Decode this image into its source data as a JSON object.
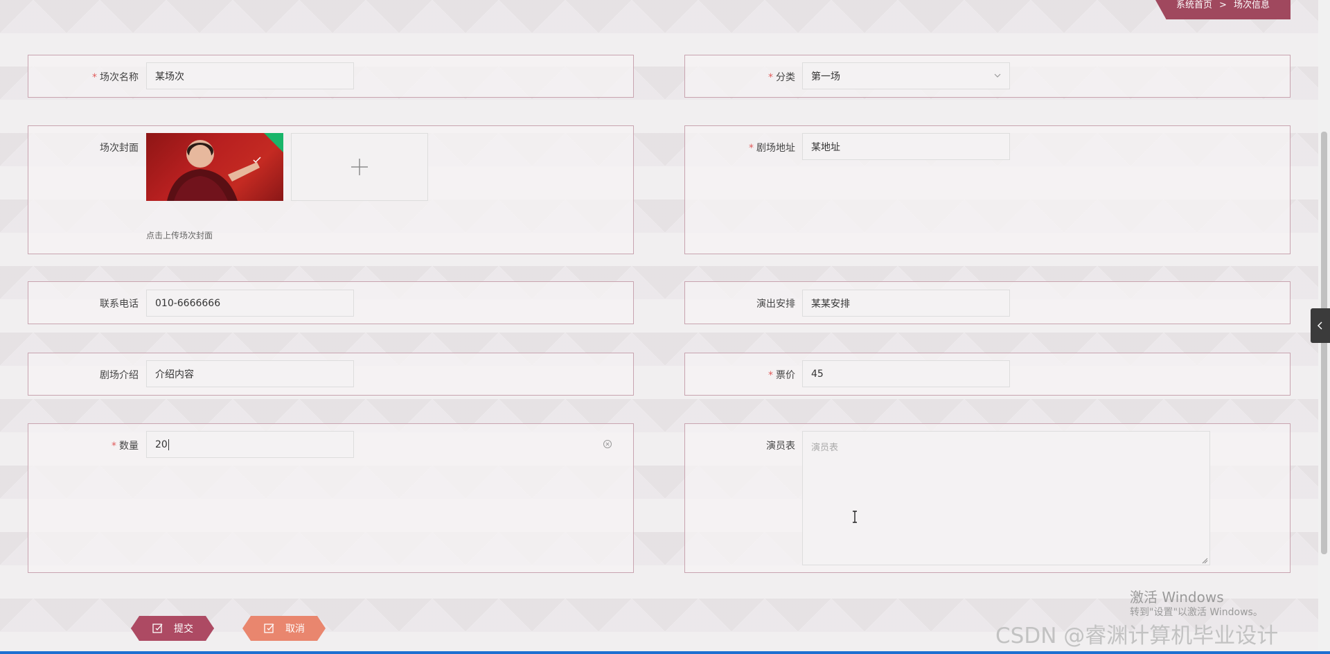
{
  "breadcrumb": {
    "home": "系统首页",
    "separator": ">",
    "current": "场次信息"
  },
  "form": {
    "name": {
      "label": "场次名称",
      "required": true,
      "value": "某场次"
    },
    "category": {
      "label": "分类",
      "required": true,
      "value": "第一场"
    },
    "cover": {
      "label": "场次封面",
      "required": false,
      "hint": "点击上传场次封面"
    },
    "address": {
      "label": "剧场地址",
      "required": true,
      "value": "某地址"
    },
    "phone": {
      "label": "联系电话",
      "required": false,
      "value": "010-6666666"
    },
    "schedule": {
      "label": "演出安排",
      "required": false,
      "value": "某某安排"
    },
    "intro": {
      "label": "剧场介绍",
      "required": false,
      "value": "介绍内容"
    },
    "price": {
      "label": "票价",
      "required": true,
      "value": "45"
    },
    "quantity": {
      "label": "数量",
      "required": true,
      "value": "20"
    },
    "cast": {
      "label": "演员表",
      "required": false,
      "placeholder": "演员表"
    }
  },
  "buttons": {
    "submit": "提交",
    "cancel": "取消"
  },
  "required_mark": "*",
  "watermarks": {
    "activate_title": "激活 Windows",
    "activate_sub": "转到\"设置\"以激活 Windows。",
    "csdn": "CSDN @睿渊计算机毕业设计"
  },
  "colors": {
    "accent": "#ad4a63",
    "cancel": "#e9866e",
    "border": "#c8a3af",
    "required": "#e05c5c"
  },
  "icons": [
    "chevron-down-icon",
    "plus-icon",
    "check-icon",
    "clear-icon",
    "edit-icon",
    "chevron-left-icon"
  ]
}
